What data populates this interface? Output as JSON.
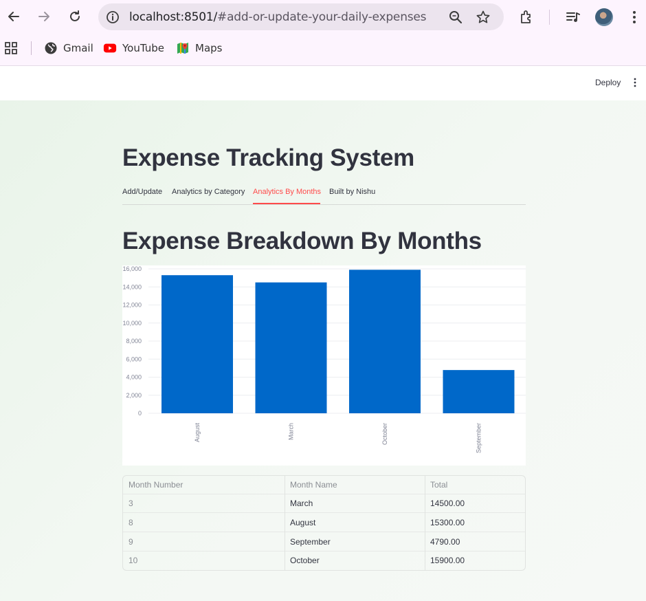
{
  "browser": {
    "url_host": "localhost:8501/",
    "url_path": "#add-or-update-your-daily-expenses",
    "bookmarks": [
      {
        "label": "Gmail",
        "icon": "globe-icon"
      },
      {
        "label": "YouTube",
        "icon": "youtube-icon"
      },
      {
        "label": "Maps",
        "icon": "maps-icon"
      }
    ]
  },
  "app_header": {
    "deploy_label": "Deploy"
  },
  "page": {
    "title": "Expense Tracking System",
    "tabs": [
      {
        "label": "Add/Update",
        "active": false
      },
      {
        "label": "Analytics by Category",
        "active": false
      },
      {
        "label": "Analytics By Months",
        "active": true
      },
      {
        "label": "Built by Nishu",
        "active": false
      }
    ],
    "section_title": "Expense Breakdown By Months"
  },
  "chart_data": {
    "type": "bar",
    "categories": [
      "August",
      "March",
      "October",
      "September"
    ],
    "values": [
      15300,
      14500,
      15900,
      4790
    ],
    "ylim": [
      0,
      16000
    ],
    "yticks": [
      "16,000",
      "14,000",
      "12,000",
      "10,000",
      "8,000",
      "6,000",
      "4,000",
      "2,000",
      "0"
    ],
    "ytick_values": [
      16000,
      14000,
      12000,
      10000,
      8000,
      6000,
      4000,
      2000,
      0
    ],
    "bar_color": "#0068c9",
    "grid": true
  },
  "table": {
    "headers": [
      "Month Number",
      "Month Name",
      "Total"
    ],
    "rows": [
      [
        "3",
        "March",
        "14500.00"
      ],
      [
        "8",
        "August",
        "15300.00"
      ],
      [
        "9",
        "September",
        "4790.00"
      ],
      [
        "10",
        "October",
        "15900.00"
      ]
    ]
  },
  "colors": {
    "accent": "#ff4b4b",
    "bar": "#0068c9",
    "text": "#31333f"
  }
}
